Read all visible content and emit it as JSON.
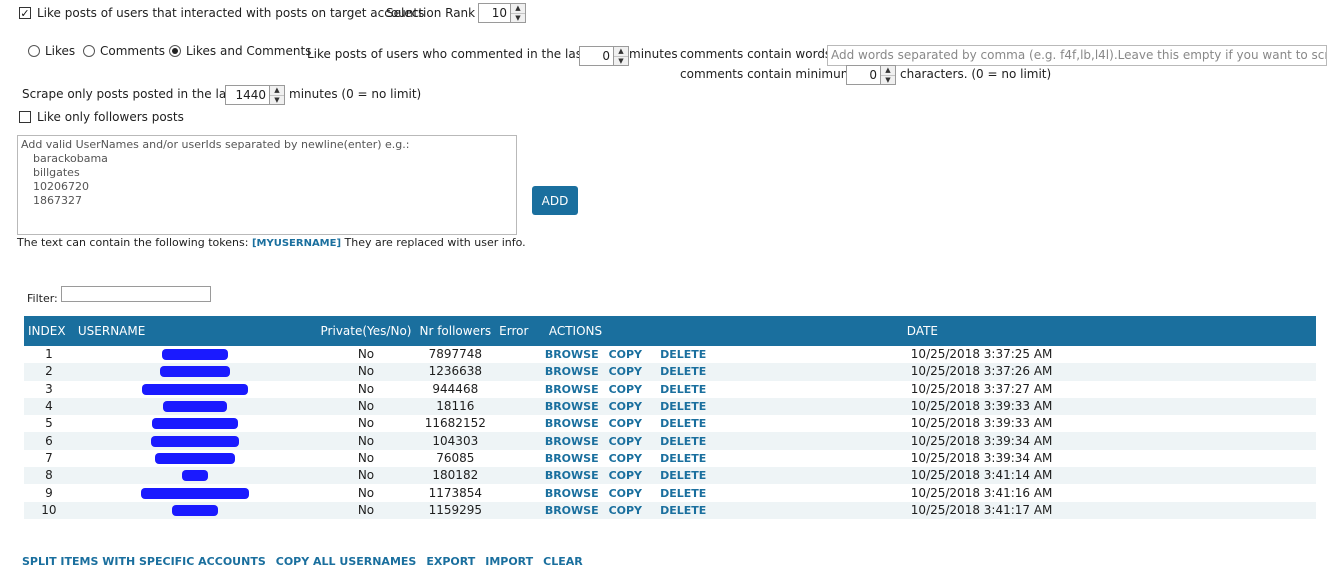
{
  "options": {
    "interacted_label": "Like posts of users that interacted with posts on target accounts",
    "interacted_checked": true,
    "selection_rank_label": "Selection Rank",
    "selection_rank_value": "10",
    "radio_likes": "Likes",
    "radio_comments": "Comments",
    "radio_likes_and_comments": "Likes and Comments",
    "selected_radio": "Likes and Comments",
    "commented_last_label": "Like posts of users who commented in the last",
    "commented_last_value": "0",
    "minutes_label": "minutes",
    "comments_contain_words_label": "comments contain words",
    "comments_words_placeholder": "Add words separated by comma (e.g. f4f,lb,l4l).Leave this empty if you want to scrape all comments",
    "comments_min_label": "comments contain minimum",
    "comments_min_value": "0",
    "characters_label": "characters. (0 = no limit)",
    "scrape_posted_label": "Scrape only posts posted in the last",
    "scrape_posted_value": "1440",
    "scrape_posted_suffix": "minutes (0 = no limit)",
    "followers_only_label": "Like only followers posts",
    "followers_only_checked": false
  },
  "users_box": {
    "placeholder_lines": [
      "Add valid UserNames and/or userIds separated by newline(enter) e.g.:",
      "barackobama",
      "billgates",
      "10206720",
      "1867327"
    ],
    "add_button": "ADD",
    "tokens_prefix": "The text can contain the following tokens:",
    "token": "[MYUSERNAME]",
    "tokens_suffix": "They are replaced with user info."
  },
  "filter": {
    "label": "Filter:",
    "value": ""
  },
  "table": {
    "columns": [
      "INDEX",
      "USERNAME",
      "Private(Yes/No)",
      "Nr followers",
      "Error",
      "ACTIONS",
      "DATE"
    ],
    "actions": [
      "BROWSE",
      "COPY",
      "DELETE"
    ],
    "rows": [
      {
        "index": "1",
        "private": "No",
        "followers": "7897748",
        "date": "10/25/2018 3:37:25 AM"
      },
      {
        "index": "2",
        "private": "No",
        "followers": "1236638",
        "date": "10/25/2018 3:37:26 AM"
      },
      {
        "index": "3",
        "private": "No",
        "followers": "944468",
        "date": "10/25/2018 3:37:27 AM"
      },
      {
        "index": "4",
        "private": "No",
        "followers": "18116",
        "date": "10/25/2018 3:39:33 AM"
      },
      {
        "index": "5",
        "private": "No",
        "followers": "11682152",
        "date": "10/25/2018 3:39:33 AM"
      },
      {
        "index": "6",
        "private": "No",
        "followers": "104303",
        "date": "10/25/2018 3:39:34 AM"
      },
      {
        "index": "7",
        "private": "No",
        "followers": "76085",
        "date": "10/25/2018 3:39:34 AM"
      },
      {
        "index": "8",
        "private": "No",
        "followers": "180182",
        "date": "10/25/2018 3:41:14 AM"
      },
      {
        "index": "9",
        "private": "No",
        "followers": "1173854",
        "date": "10/25/2018 3:41:16 AM"
      },
      {
        "index": "10",
        "private": "No",
        "followers": "1159295",
        "date": "10/25/2018 3:41:17 AM"
      }
    ]
  },
  "bottom_links": [
    "SPLIT ITEMS WITH SPECIFIC ACCOUNTS",
    "COPY ALL USERNAMES",
    "EXPORT",
    "IMPORT",
    "CLEAR"
  ],
  "colors": {
    "accent": "#1a6f9e",
    "redaction": "#1a1aff",
    "stripe": "#eef4f6"
  }
}
